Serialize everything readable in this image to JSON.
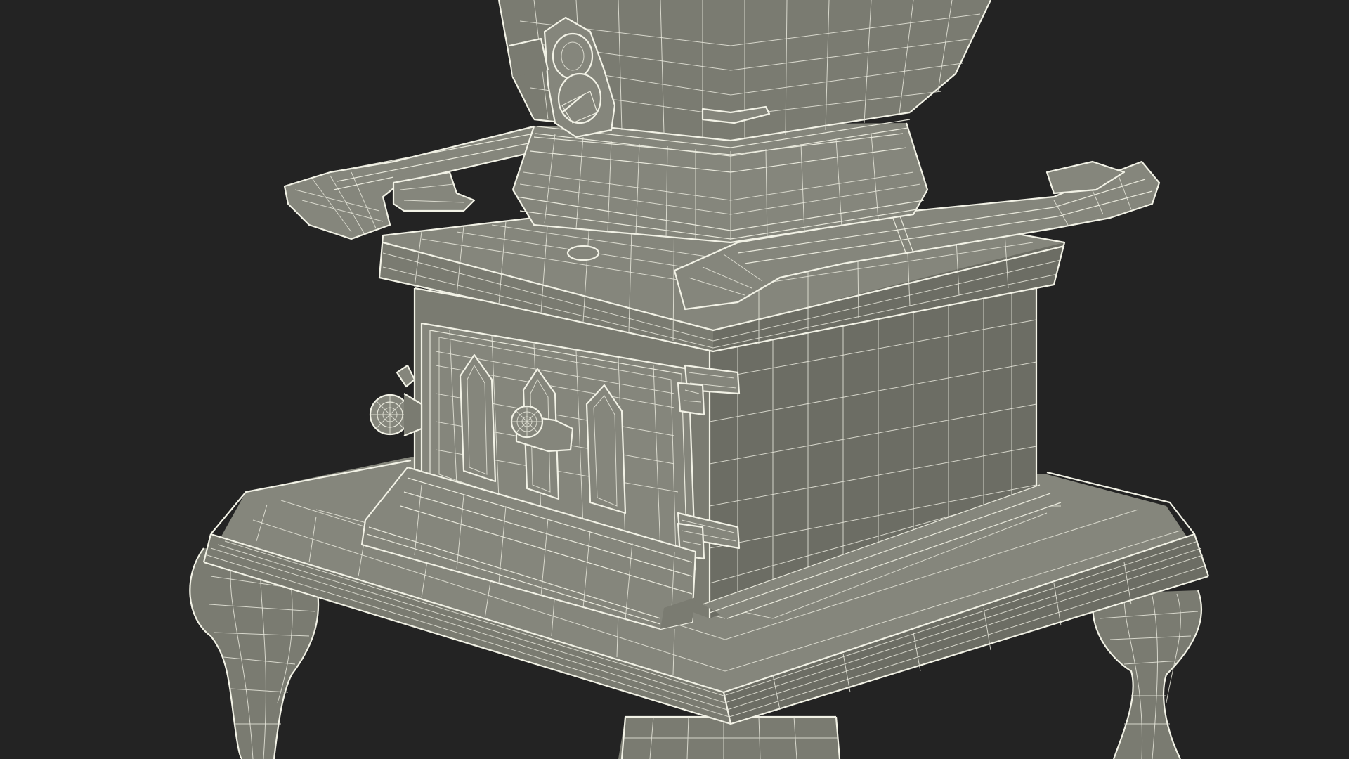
{
  "scene": {
    "subject": "wireframe-render-of-stove",
    "colors": {
      "background": "#232323",
      "surface": "#7a7b71",
      "wireframe": "#eeeee2"
    }
  }
}
